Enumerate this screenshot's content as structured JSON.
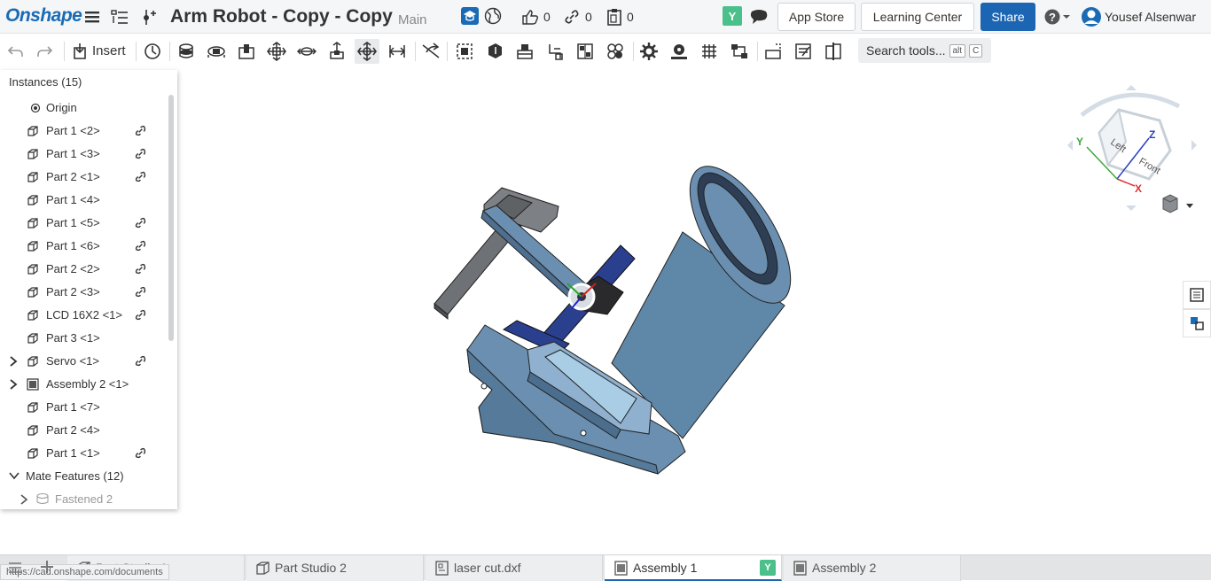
{
  "header": {
    "logo": "Onshape",
    "doc_title": "Arm Robot - Copy - Copy",
    "branch": "Main",
    "likes": "0",
    "links": "0",
    "copies": "0",
    "user_badge": "Y",
    "app_store": "App Store",
    "learning_center": "Learning Center",
    "share": "Share",
    "username": "Yousef Alsenwar"
  },
  "toolbar": {
    "insert_label": "Insert",
    "search_label": "Search tools...",
    "shortcut_key1": "alt",
    "shortcut_key2": "C"
  },
  "instances": {
    "title": "Instances (15)",
    "items": [
      {
        "label": "Origin",
        "kind": "origin",
        "linked": false,
        "expandable": false
      },
      {
        "label": "Part 1 <2>",
        "kind": "part",
        "linked": true,
        "expandable": false
      },
      {
        "label": "Part 1 <3>",
        "kind": "part",
        "linked": true,
        "expandable": false
      },
      {
        "label": "Part 2 <1>",
        "kind": "part",
        "linked": true,
        "expandable": false
      },
      {
        "label": "Part 1 <4>",
        "kind": "part",
        "linked": false,
        "expandable": false
      },
      {
        "label": "Part 1 <5>",
        "kind": "part",
        "linked": true,
        "expandable": false
      },
      {
        "label": "Part 1 <6>",
        "kind": "part",
        "linked": true,
        "expandable": false
      },
      {
        "label": "Part 2 <2>",
        "kind": "part",
        "linked": true,
        "expandable": false
      },
      {
        "label": "Part 2 <3>",
        "kind": "part",
        "linked": true,
        "expandable": false
      },
      {
        "label": "LCD 16X2 <1>",
        "kind": "part",
        "linked": true,
        "expandable": false
      },
      {
        "label": "Part 3 <1>",
        "kind": "part",
        "linked": false,
        "expandable": false
      },
      {
        "label": "Servo <1>",
        "kind": "part",
        "linked": true,
        "expandable": true
      },
      {
        "label": "Assembly 2 <1>",
        "kind": "assembly",
        "linked": false,
        "expandable": true
      },
      {
        "label": "Part 1 <7>",
        "kind": "part",
        "linked": false,
        "expandable": false
      },
      {
        "label": "Part 2 <4>",
        "kind": "part",
        "linked": false,
        "expandable": false
      },
      {
        "label": "Part 1 <1>",
        "kind": "part",
        "linked": true,
        "expandable": false
      }
    ],
    "mate_features": "Mate Features (12)",
    "mate_first": "Fastened 2"
  },
  "viewcube": {
    "face_left": "Left",
    "face_front": "Front",
    "axis_x": "X",
    "axis_y": "Y",
    "axis_z": "Z"
  },
  "tabs": [
    {
      "label": "Part Studio 1",
      "icon": "part-studio-icon",
      "active": false
    },
    {
      "label": "Part Studio 2",
      "icon": "part-studio-icon",
      "active": false
    },
    {
      "label": "laser cut.dxf",
      "icon": "file-icon",
      "active": false
    },
    {
      "label": "Assembly 1",
      "icon": "assembly-icon",
      "active": true,
      "badge": "Y"
    },
    {
      "label": "Assembly 2",
      "icon": "assembly-icon",
      "active": false
    }
  ],
  "status_url": "https://cad.onshape.com/documents",
  "colors": {
    "brand": "#1a6bb5",
    "share": "#1b65b3",
    "badge_green": "#4cc08a",
    "model_blue": "#5f87a8",
    "model_dark_blue": "#2b3f8f",
    "model_gray": "#7a7d80"
  }
}
